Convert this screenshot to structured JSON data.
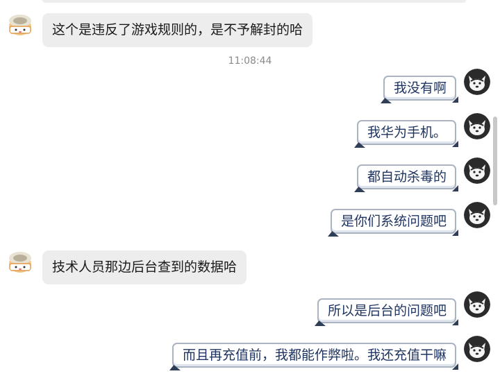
{
  "chat": {
    "timestamp": "11:08:44",
    "messages": [
      {
        "side": "in",
        "text": "这个是违反了游戏规则的，是不予解封的哈"
      },
      {
        "side": "out",
        "text": "我没有啊"
      },
      {
        "side": "out",
        "text": "我华为手机。"
      },
      {
        "side": "out",
        "text": "都自动杀毒的"
      },
      {
        "side": "out",
        "text": "是你们系统问题吧"
      },
      {
        "side": "in",
        "text": "技术人员那边后台查到的数据哈"
      },
      {
        "side": "out",
        "text": "所以是后台的问题吧"
      },
      {
        "side": "out",
        "text": "而且再充值前，我都能作弊啦。我还充值干嘛"
      }
    ]
  },
  "avatars": {
    "agent": "cartoon-cat-avatar-icon",
    "user": "dark-dog-avatar-icon"
  },
  "colors": {
    "incoming_bubble": "#ededed",
    "outgoing_text": "#1f3460",
    "outgoing_border": "#a9b3c2"
  }
}
